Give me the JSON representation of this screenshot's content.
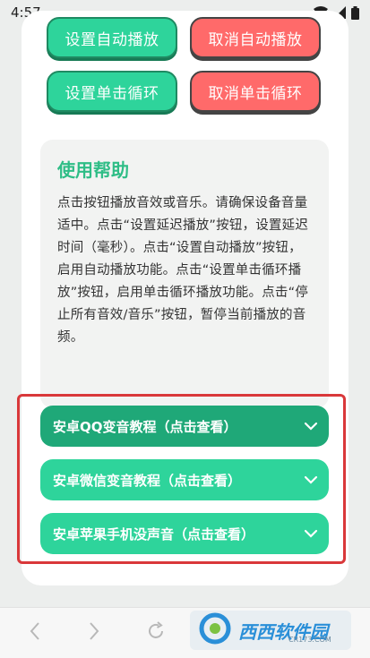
{
  "status_bar": {
    "time": "4:57"
  },
  "buttons": {
    "set_autoplay": "设置自动播放",
    "cancel_autoplay": "取消自动播放",
    "set_single_loop": "设置单击循环",
    "cancel_single_loop": "取消单击循环"
  },
  "help": {
    "title": "使用帮助",
    "body": "点击按钮播放音效或音乐。请确保设备音量适中。点击“设置延迟播放”按钮，设置延迟时间（毫秒）。点击“设置自动播放”按钮，启用自动播放功能。点击“设置单击循环播放”按钮，启用单击循环播放功能。点击“停止所有音效/音乐”按钮，暂停当前播放的音频。"
  },
  "tutorials": [
    {
      "label": "安卓QQ变音教程（点击查看）",
      "color": "#1fa878"
    },
    {
      "label": "安卓微信变音教程（点击查看）",
      "color": "#2ed49b"
    },
    {
      "label": "安卓苹果手机没声音（点击查看）",
      "color": "#2ed49b"
    }
  ],
  "watermark": {
    "logo_text": "西西软件园",
    "site": "CR173.COM"
  },
  "colors": {
    "accent_green": "#2ed49b",
    "accent_red": "#ff6a6a",
    "highlight_border": "#d9383a"
  }
}
